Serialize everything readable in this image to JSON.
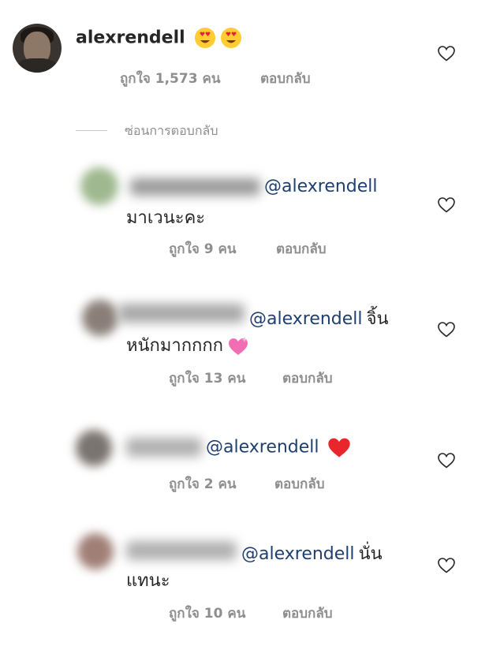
{
  "main_comment": {
    "username": "alexrendell",
    "likes_text": "ถูกใจ 1,573 คน",
    "reply_label": "ตอบกลับ"
  },
  "hide_replies_label": "ซ่อนการตอบกลับ",
  "replies": [
    {
      "mention": "@alexrendell",
      "text_inline": "",
      "text_line2": "มาเวนะคะ",
      "likes_text": "ถูกใจ 9 คน",
      "reply_label": "ตอบกลับ",
      "avatar_color": "#9fb88f",
      "name_color": "#9a9a9a"
    },
    {
      "mention": "@alexrendell",
      "text_inline": "จิ้น",
      "text_line2": "หนักมากกกก",
      "likes_text": "ถูกใจ 13 คน",
      "reply_label": "ตอบกลับ",
      "avatar_color": "#8a7f78",
      "name_color": "#a8a8a8"
    },
    {
      "mention": "@alexrendell",
      "text_inline": "",
      "text_line2": "",
      "likes_text": "ถูกใจ 2 คน",
      "reply_label": "ตอบกลับ",
      "avatar_color": "#7a7470",
      "name_color": "#b0b0b0"
    },
    {
      "mention": "@alexrendell",
      "text_inline": "นั่น",
      "text_line2": "แทนะ",
      "likes_text": "ถูกใจ 10 คน",
      "reply_label": "ตอบกลับ",
      "avatar_color": "#a07f76",
      "name_color": "#b0b0b0"
    }
  ],
  "icons": {
    "heart_eyes": "heart-eyes-emoji",
    "sparkling_heart": "sparkling-heart-emoji",
    "red_heart": "red-heart-emoji",
    "like": "heart-outline-icon"
  },
  "colors": {
    "mention": "#1f3f6e",
    "meta": "#8e8e8e",
    "text": "#262626"
  }
}
